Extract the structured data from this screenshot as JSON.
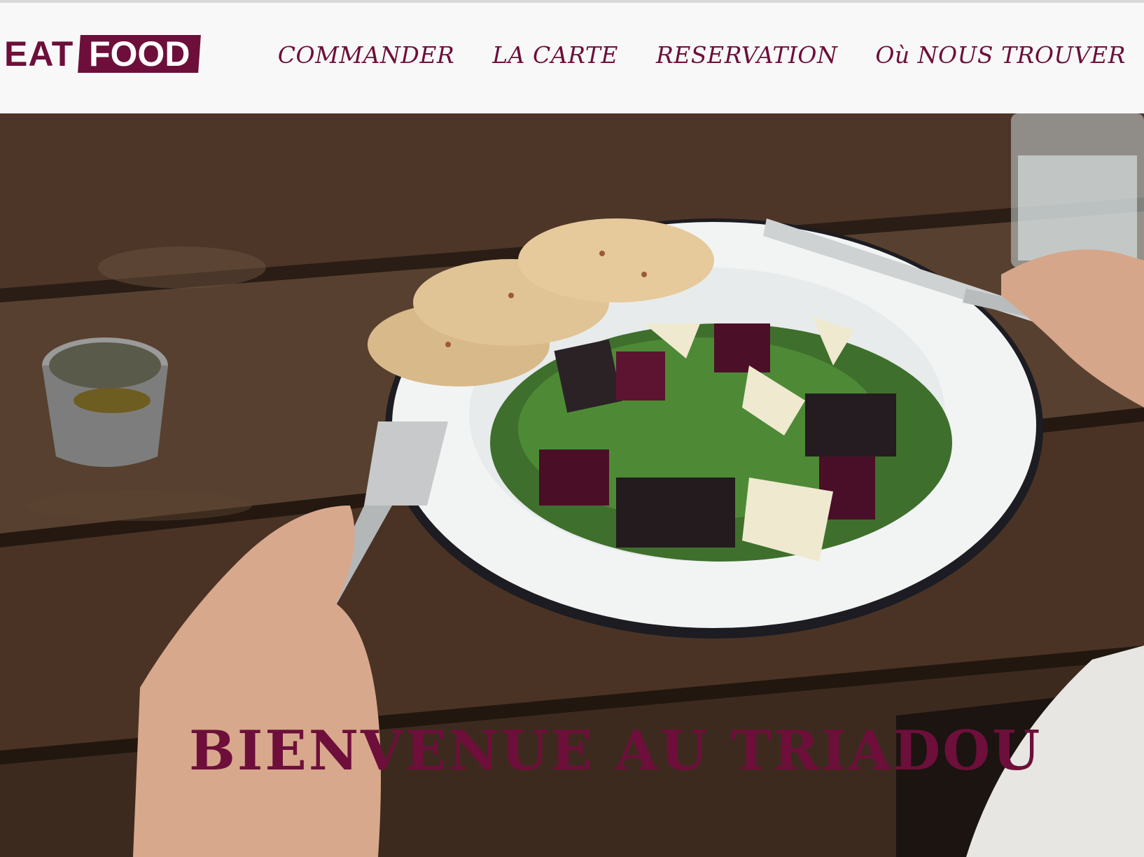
{
  "logo": {
    "eat": "EAT",
    "food": "FOOD"
  },
  "nav": {
    "items": [
      {
        "label": "COMMANDER"
      },
      {
        "label": "LA CARTE"
      },
      {
        "label": "RESERVATION"
      },
      {
        "label": "Où NOUS TROUVER"
      }
    ]
  },
  "hero": {
    "title": "BIENVENUE AU TRIADOU",
    "image_description_icon": "salad-plate-photo"
  },
  "colors": {
    "brand": "#6d0f3a",
    "header_bg": "#f8f8f8",
    "wood": "#4a3426"
  }
}
